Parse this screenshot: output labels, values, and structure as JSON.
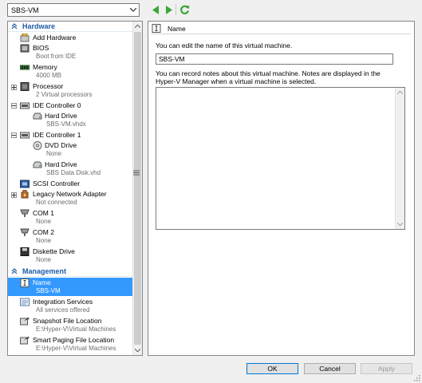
{
  "toolbar": {
    "vm_selector_value": "SBS-VM",
    "back_icon": "back-arrow-icon",
    "forward_icon": "forward-arrow-icon",
    "refresh_icon": "refresh-icon",
    "accent_green": "#3aa63a"
  },
  "sidebar": {
    "hardware_header": "Hardware",
    "management_header": "Management",
    "hardware_items": [
      {
        "label": "Add Hardware",
        "sub": "",
        "icon": "add-hardware-icon"
      },
      {
        "label": "BIOS",
        "sub": "Boot from IDE",
        "icon": "bios-icon"
      },
      {
        "label": "Memory",
        "sub": "4000 MB",
        "icon": "memory-icon"
      },
      {
        "label": "Processor",
        "sub": "2 Virtual processors",
        "icon": "processor-icon"
      },
      {
        "label": "IDE Controller 0",
        "sub": "",
        "icon": "ide-controller-icon"
      },
      {
        "label": "Hard Drive",
        "sub": "SBS-VM.vhdx",
        "icon": "hard-drive-icon"
      },
      {
        "label": "IDE Controller 1",
        "sub": "",
        "icon": "ide-controller-icon"
      },
      {
        "label": "DVD Drive",
        "sub": "None",
        "icon": "dvd-drive-icon"
      },
      {
        "label": "Hard Drive",
        "sub": "SBS Data Disk.vhd",
        "icon": "hard-drive-icon"
      },
      {
        "label": "SCSI Controller",
        "sub": "",
        "icon": "scsi-controller-icon"
      },
      {
        "label": "Legacy Network Adapter",
        "sub": "Not connected",
        "icon": "network-adapter-icon"
      },
      {
        "label": "COM 1",
        "sub": "None",
        "icon": "com-port-icon"
      },
      {
        "label": "COM 2",
        "sub": "None",
        "icon": "com-port-icon"
      },
      {
        "label": "Diskette Drive",
        "sub": "None",
        "icon": "diskette-drive-icon"
      }
    ],
    "management_items": [
      {
        "label": "Name",
        "sub": "SBS-VM",
        "icon": "name-icon"
      },
      {
        "label": "Integration Services",
        "sub": "All services offered",
        "icon": "integration-services-icon"
      },
      {
        "label": "Snapshot File Location",
        "sub": "E:\\Hyper-V\\Virtual Machines",
        "icon": "snapshot-folder-icon"
      },
      {
        "label": "Smart Paging File Location",
        "sub": "E:\\Hyper-V\\Virtual Machines",
        "icon": "paging-folder-icon"
      }
    ],
    "header_color": "#1e5aa8",
    "selected_color": "#3399ff"
  },
  "details": {
    "title": "Name",
    "name_hint": "You can edit the name of this virtual machine.",
    "name_value": "SBS-VM",
    "notes_hint": "You can record notes about this virtual machine. Notes are displayed in the Hyper-V Manager when a virtual machine is selected.",
    "notes_value": ""
  },
  "buttons": {
    "ok": "OK",
    "cancel": "Cancel",
    "apply": "Apply"
  }
}
